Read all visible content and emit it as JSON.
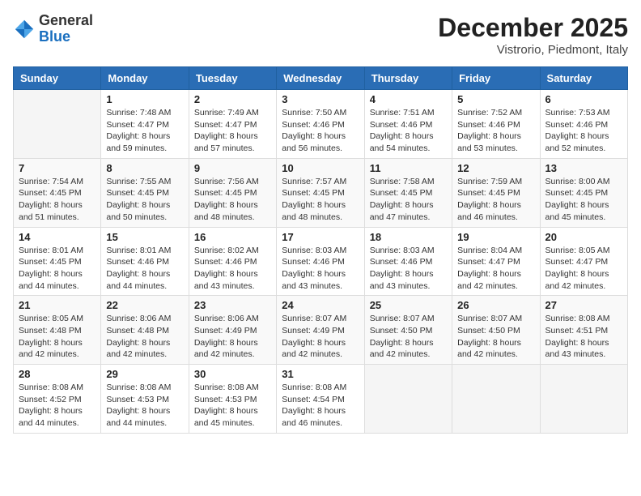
{
  "header": {
    "logo": {
      "general": "General",
      "blue": "Blue"
    },
    "title": "December 2025",
    "location": "Vistrorio, Piedmont, Italy"
  },
  "calendar": {
    "days_of_week": [
      "Sunday",
      "Monday",
      "Tuesday",
      "Wednesday",
      "Thursday",
      "Friday",
      "Saturday"
    ],
    "weeks": [
      [
        {
          "day": "",
          "info": ""
        },
        {
          "day": "1",
          "info": "Sunrise: 7:48 AM\nSunset: 4:47 PM\nDaylight: 8 hours\nand 59 minutes."
        },
        {
          "day": "2",
          "info": "Sunrise: 7:49 AM\nSunset: 4:47 PM\nDaylight: 8 hours\nand 57 minutes."
        },
        {
          "day": "3",
          "info": "Sunrise: 7:50 AM\nSunset: 4:46 PM\nDaylight: 8 hours\nand 56 minutes."
        },
        {
          "day": "4",
          "info": "Sunrise: 7:51 AM\nSunset: 4:46 PM\nDaylight: 8 hours\nand 54 minutes."
        },
        {
          "day": "5",
          "info": "Sunrise: 7:52 AM\nSunset: 4:46 PM\nDaylight: 8 hours\nand 53 minutes."
        },
        {
          "day": "6",
          "info": "Sunrise: 7:53 AM\nSunset: 4:46 PM\nDaylight: 8 hours\nand 52 minutes."
        }
      ],
      [
        {
          "day": "7",
          "info": "Sunrise: 7:54 AM\nSunset: 4:45 PM\nDaylight: 8 hours\nand 51 minutes."
        },
        {
          "day": "8",
          "info": "Sunrise: 7:55 AM\nSunset: 4:45 PM\nDaylight: 8 hours\nand 50 minutes."
        },
        {
          "day": "9",
          "info": "Sunrise: 7:56 AM\nSunset: 4:45 PM\nDaylight: 8 hours\nand 48 minutes."
        },
        {
          "day": "10",
          "info": "Sunrise: 7:57 AM\nSunset: 4:45 PM\nDaylight: 8 hours\nand 48 minutes."
        },
        {
          "day": "11",
          "info": "Sunrise: 7:58 AM\nSunset: 4:45 PM\nDaylight: 8 hours\nand 47 minutes."
        },
        {
          "day": "12",
          "info": "Sunrise: 7:59 AM\nSunset: 4:45 PM\nDaylight: 8 hours\nand 46 minutes."
        },
        {
          "day": "13",
          "info": "Sunrise: 8:00 AM\nSunset: 4:45 PM\nDaylight: 8 hours\nand 45 minutes."
        }
      ],
      [
        {
          "day": "14",
          "info": "Sunrise: 8:01 AM\nSunset: 4:45 PM\nDaylight: 8 hours\nand 44 minutes."
        },
        {
          "day": "15",
          "info": "Sunrise: 8:01 AM\nSunset: 4:46 PM\nDaylight: 8 hours\nand 44 minutes."
        },
        {
          "day": "16",
          "info": "Sunrise: 8:02 AM\nSunset: 4:46 PM\nDaylight: 8 hours\nand 43 minutes."
        },
        {
          "day": "17",
          "info": "Sunrise: 8:03 AM\nSunset: 4:46 PM\nDaylight: 8 hours\nand 43 minutes."
        },
        {
          "day": "18",
          "info": "Sunrise: 8:03 AM\nSunset: 4:46 PM\nDaylight: 8 hours\nand 43 minutes."
        },
        {
          "day": "19",
          "info": "Sunrise: 8:04 AM\nSunset: 4:47 PM\nDaylight: 8 hours\nand 42 minutes."
        },
        {
          "day": "20",
          "info": "Sunrise: 8:05 AM\nSunset: 4:47 PM\nDaylight: 8 hours\nand 42 minutes."
        }
      ],
      [
        {
          "day": "21",
          "info": "Sunrise: 8:05 AM\nSunset: 4:48 PM\nDaylight: 8 hours\nand 42 minutes."
        },
        {
          "day": "22",
          "info": "Sunrise: 8:06 AM\nSunset: 4:48 PM\nDaylight: 8 hours\nand 42 minutes."
        },
        {
          "day": "23",
          "info": "Sunrise: 8:06 AM\nSunset: 4:49 PM\nDaylight: 8 hours\nand 42 minutes."
        },
        {
          "day": "24",
          "info": "Sunrise: 8:07 AM\nSunset: 4:49 PM\nDaylight: 8 hours\nand 42 minutes."
        },
        {
          "day": "25",
          "info": "Sunrise: 8:07 AM\nSunset: 4:50 PM\nDaylight: 8 hours\nand 42 minutes."
        },
        {
          "day": "26",
          "info": "Sunrise: 8:07 AM\nSunset: 4:50 PM\nDaylight: 8 hours\nand 42 minutes."
        },
        {
          "day": "27",
          "info": "Sunrise: 8:08 AM\nSunset: 4:51 PM\nDaylight: 8 hours\nand 43 minutes."
        }
      ],
      [
        {
          "day": "28",
          "info": "Sunrise: 8:08 AM\nSunset: 4:52 PM\nDaylight: 8 hours\nand 44 minutes."
        },
        {
          "day": "29",
          "info": "Sunrise: 8:08 AM\nSunset: 4:53 PM\nDaylight: 8 hours\nand 44 minutes."
        },
        {
          "day": "30",
          "info": "Sunrise: 8:08 AM\nSunset: 4:53 PM\nDaylight: 8 hours\nand 45 minutes."
        },
        {
          "day": "31",
          "info": "Sunrise: 8:08 AM\nSunset: 4:54 PM\nDaylight: 8 hours\nand 46 minutes."
        },
        {
          "day": "",
          "info": ""
        },
        {
          "day": "",
          "info": ""
        },
        {
          "day": "",
          "info": ""
        }
      ]
    ]
  }
}
